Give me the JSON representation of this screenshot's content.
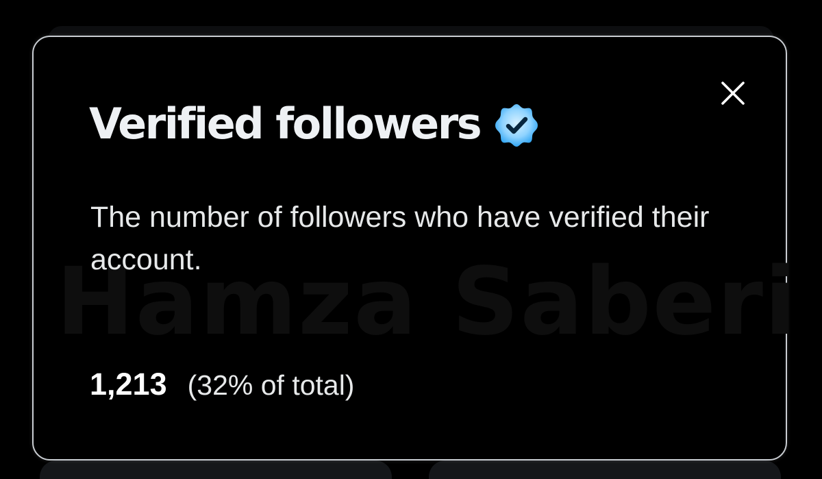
{
  "modal": {
    "title": "Verified followers",
    "description": "The number of followers who have verified their account.",
    "count": "1,213",
    "percent_of_total": "(32% of total)",
    "close_icon": "close-icon",
    "badge_icon": "verified-badge-icon"
  },
  "watermark": {
    "text": "Hamza Saberi"
  },
  "colors": {
    "background": "#000000",
    "border": "#c9cdd2",
    "text_primary": "#eef1f4",
    "badge_blue": "#1d9bf0",
    "badge_light": "#8fd3ff"
  }
}
